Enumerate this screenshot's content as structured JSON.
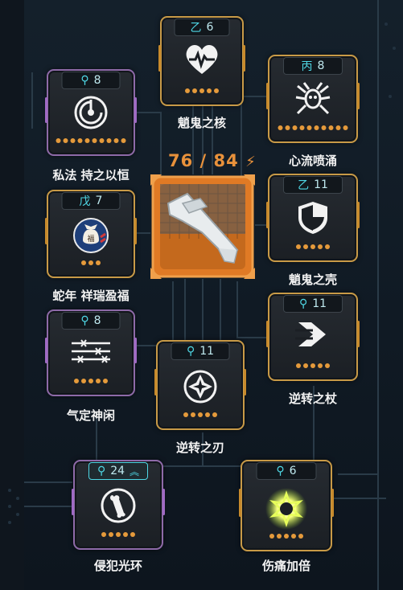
{
  "center": {
    "value": "76",
    "max": "84",
    "separator": "/",
    "bolt": "⚡"
  },
  "cards": [
    {
      "id": "ghost-core",
      "header_badge": "乙",
      "header_num": "6",
      "label": "魈鬼之核",
      "dots": 5,
      "style": "gold",
      "icon": "heart-pulse-icon"
    },
    {
      "id": "private-law",
      "header_badge": "⚲",
      "header_num": "8",
      "label": "私法 持之以恒",
      "dots": 10,
      "style": "purple",
      "icon": "timer-circle-icon"
    },
    {
      "id": "heart-surge",
      "header_badge": "丙",
      "header_num": "8",
      "label": "心流喷涌",
      "dots": 10,
      "style": "gold",
      "icon": "spider-icon"
    },
    {
      "id": "snake-year",
      "header_badge": "戊",
      "header_num": "7",
      "label": "蛇年 祥瑞盈福",
      "dots": 3,
      "style": "gold",
      "icon": "fortune-bag-icon"
    },
    {
      "id": "ghost-shell",
      "header_badge": "乙",
      "header_num": "11",
      "label": "魈鬼之壳",
      "dots": 5,
      "style": "gold",
      "icon": "shield-icon"
    },
    {
      "id": "calm-mind",
      "header_badge": "⚲",
      "header_num": "8",
      "label": "气定神闲",
      "dots": 5,
      "style": "purple",
      "icon": "barbed-wire-icon"
    },
    {
      "id": "reverse-staff",
      "header_badge": "⚲",
      "header_num": "11",
      "label": "逆转之杖",
      "dots": 5,
      "style": "gold",
      "icon": "arrow-right-icon"
    },
    {
      "id": "reverse-blade",
      "header_badge": "⚲",
      "header_num": "11",
      "label": "逆转之刃",
      "dots": 5,
      "style": "gold",
      "icon": "blade-emblem-icon"
    },
    {
      "id": "invasion-aura",
      "header_badge": "⚲",
      "header_num": "24",
      "label": "侵犯光环",
      "dots": 5,
      "style": "purple",
      "icon": "bone-circle-icon",
      "upgrade": "︽"
    },
    {
      "id": "double-pain",
      "header_badge": "⚲",
      "header_num": "6",
      "label": "伤痛加倍",
      "dots": 5,
      "style": "gold",
      "icon": "glowing-orb-icon"
    }
  ],
  "colors": {
    "accent": "#e8913b",
    "teal": "#4fd8e6",
    "gold": "#c89a47",
    "purple": "#8e6aa8",
    "dot": "#e59a3b"
  }
}
